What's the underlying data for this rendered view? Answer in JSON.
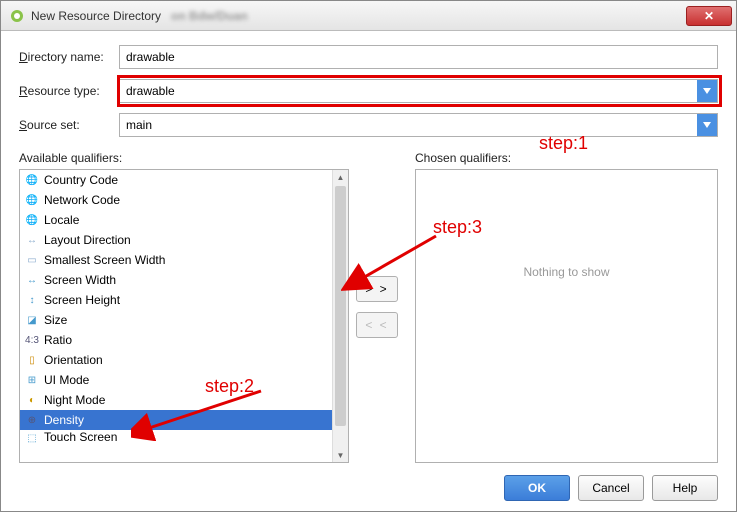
{
  "titlebar": {
    "title": "New Resource Directory",
    "blur_text": "on  Bdw/Duan",
    "close_glyph": "✕"
  },
  "form": {
    "directory_name_label": "Directory name:",
    "directory_name_value": "drawable",
    "resource_type_label": "Resource type:",
    "resource_type_value": "drawable",
    "source_set_label": "Source set:",
    "source_set_value": "main"
  },
  "available": {
    "label": "Available qualifiers:",
    "items": [
      {
        "icon": "globe-icon",
        "glyph": "🌐",
        "color": "#2a9",
        "label": "Country Code"
      },
      {
        "icon": "globe-icon",
        "glyph": "🌐",
        "color": "#2a9",
        "label": "Network Code"
      },
      {
        "icon": "globe-icon",
        "glyph": "🌐",
        "color": "#49c",
        "label": "Locale"
      },
      {
        "icon": "layout-icon",
        "glyph": "↔",
        "color": "#8ac",
        "label": "Layout Direction"
      },
      {
        "icon": "width-icon",
        "glyph": "▭",
        "color": "#8ac",
        "label": "Smallest Screen Width"
      },
      {
        "icon": "width-icon",
        "glyph": "↔",
        "color": "#49c",
        "label": "Screen Width"
      },
      {
        "icon": "height-icon",
        "glyph": "↕",
        "color": "#49c",
        "label": "Screen Height"
      },
      {
        "icon": "size-icon",
        "glyph": "◪",
        "color": "#49c",
        "label": "Size"
      },
      {
        "icon": "ratio-icon",
        "glyph": "4:3",
        "color": "#557",
        "label": "Ratio"
      },
      {
        "icon": "orientation-icon",
        "glyph": "▯",
        "color": "#c80",
        "label": "Orientation"
      },
      {
        "icon": "ui-mode-icon",
        "glyph": "⊞",
        "color": "#49c",
        "label": "UI Mode"
      },
      {
        "icon": "night-icon",
        "glyph": "◐",
        "color": "#c90",
        "label": "Night Mode"
      },
      {
        "icon": "density-icon",
        "glyph": "⊕",
        "color": "#557",
        "label": "Density",
        "selected": true
      },
      {
        "icon": "touch-icon",
        "glyph": "⬚",
        "color": "#49c",
        "label": "Touch Screen",
        "clipped": true
      }
    ]
  },
  "chosen": {
    "label": "Chosen qualifiers:",
    "empty_text": "Nothing to show"
  },
  "move": {
    "add": "> >",
    "remove": "< <"
  },
  "buttons": {
    "ok": "OK",
    "cancel": "Cancel",
    "help": "Help"
  },
  "annotations": {
    "step1": "step:1",
    "step2": "step:2",
    "step3": "step:3"
  }
}
